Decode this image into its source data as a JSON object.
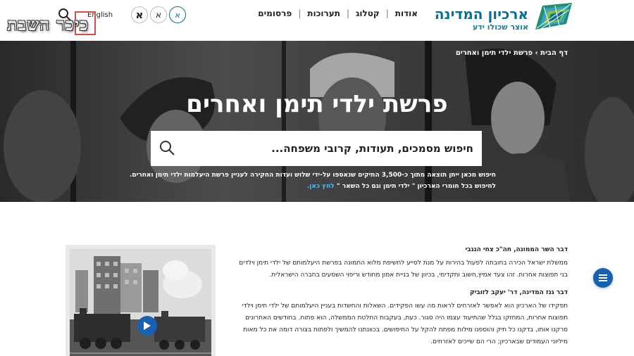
{
  "header": {
    "logo_title": "ארכיון המדינה",
    "logo_subtitle": "אוצר שכולו ידע",
    "nav": [
      "פרסומים",
      "תערוכות",
      "קטלוג",
      "אודות"
    ],
    "font_size_buttons": [
      "א",
      "א",
      "א"
    ],
    "language_link": "English",
    "icons": {
      "search": "search-icon"
    }
  },
  "watermark": {
    "text": "כיכר השבת"
  },
  "hero": {
    "breadcrumb": {
      "home": "דף הבית",
      "separator": "›",
      "current": "פרשת ילדי תימן ואחרים"
    },
    "title": "פרשת ילדי תימן ואחרים",
    "search_placeholder": "חיפוש מסמכים, תעודות, קרובי משפחה...",
    "desc_line1": "חיפוש מכאן ייתן תוצאה מתוך כ-3,500 התיקים שנאספו על-ידי שלוש ועדות החקירה לעניין פרשת היעלמות ילדי תימן ואחרים.",
    "desc_line2": "לחיפוש בכל חומרי הארכיון \" ילדי תימן וגם כל השאר \"",
    "desc_link": "לחץ כאן."
  },
  "content": {
    "section1_heading": "דבר השר הממונה, חה\"כ צחי הנגבי",
    "section1_text": "ממשלת ישראל הכירה בחובתה לפעול בהירות על מנת לסייע לחשיפת מלוא התמונה בפרשת היעלמותם של ילדי תימן וילדים בני תפוצות אחרות. זהו צעד אמיץ,חשוב ותקדימי, בכיוון של בניית אמון מחודש וריפוי השסעים בחברה הישראלית.",
    "section2_heading": "דבר גנז המדינה, דר' יעקב לזוביק",
    "section2_text": "תפקידו של הארכיון הוא לאפשר לאזרחים לראות מה עשו הפקידים. השאלות והחשדות בעניין היעלמותם של ילדי תימן וילדי תפוצות אחרות, המחזקו בגלל שהתיעוד עצמו היה סגור. כעת, בעקבות החלטת הממשלה, הוא פתוח. בחודשים האחרונים סרקנו אותו, בדקנו כל תיק והוספנו מילות מפתח להקל על החיפושים. בכוונתנו להמשיך ולפתוח בצורה דומה את כל מאות מיליוני העמודים שבארכיון; הרי הם שייכים לאזרחים."
  },
  "colors": {
    "brand": "#0a6f8f",
    "accent": "#1761b5",
    "link": "#4fb8e8"
  }
}
